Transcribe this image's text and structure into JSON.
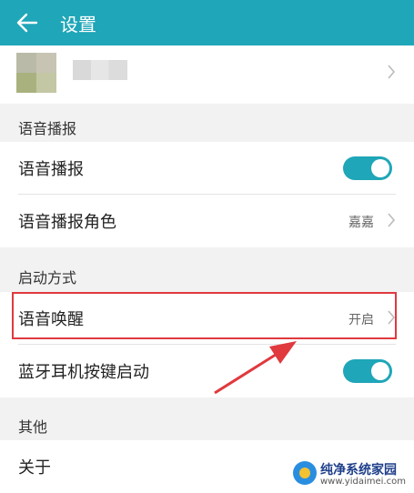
{
  "header": {
    "title": "设置"
  },
  "sections": {
    "voice_broadcast": {
      "label": "语音播报",
      "rows": {
        "broadcast": {
          "label": "语音播报",
          "toggle_on": true
        },
        "role": {
          "label": "语音播报角色",
          "value": "嘉嘉"
        }
      }
    },
    "launch": {
      "label": "启动方式",
      "rows": {
        "wake": {
          "label": "语音唤醒",
          "value": "开启"
        },
        "bluetooth": {
          "label": "蓝牙耳机按键启动",
          "toggle_on": true
        }
      }
    },
    "other": {
      "label": "其他",
      "rows": {
        "about": {
          "label": "关于"
        }
      }
    }
  },
  "colors": {
    "accent": "#1fa6b8",
    "highlight": "#e0393e"
  },
  "watermark": {
    "name": "纯净系统家园",
    "url": "www.yidaimei.com"
  }
}
